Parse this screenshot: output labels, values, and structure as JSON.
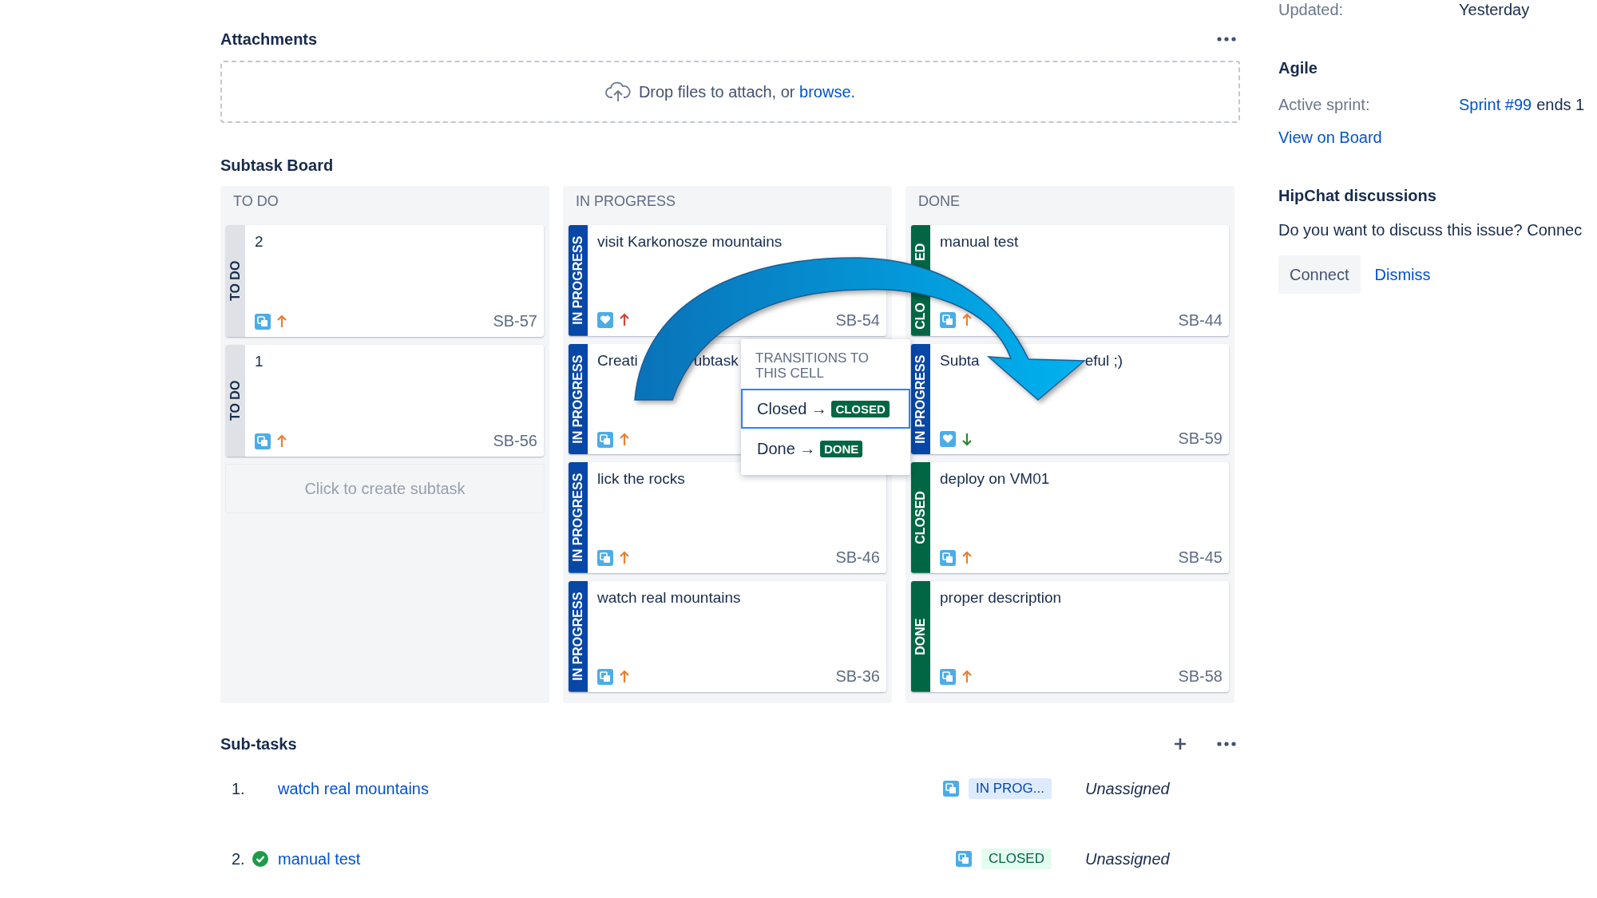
{
  "attachments": {
    "title": "Attachments",
    "dropzone_text": "Drop files to attach, or ",
    "dropzone_link": "browse."
  },
  "subtask_board": {
    "title": "Subtask Board",
    "columns": [
      {
        "name": "TO DO",
        "cards": [
          {
            "status": [
              "TO DO"
            ],
            "color": "#dfe1e6",
            "title": [
              "2"
            ],
            "kind": "subtask",
            "priority": {
              "kind": "up",
              "color": "#e97f33"
            },
            "key": "SB-57"
          },
          {
            "status": [
              "TO DO"
            ],
            "color": "#dfe1e6",
            "title": [
              "1"
            ],
            "kind": "subtask",
            "priority": {
              "kind": "up",
              "color": "#e97f33"
            },
            "key": "SB-56"
          }
        ],
        "create_text": "Click to create subtask"
      },
      {
        "name": "IN PROGRESS",
        "cards": [
          {
            "status": [
              "IN PROGRESS"
            ],
            "color": "#0747a6",
            "title": [
              "visit Karkonosze mountains"
            ],
            "kind": "story",
            "priority": {
              "kind": "up",
              "color": "#d04437"
            },
            "key": "SB-54"
          },
          {
            "status": [
              "IN PROGRESS"
            ],
            "color": "#0747a6",
            "title": [
              "Creati",
              "ubtask"
            ],
            "kind": "subtask",
            "priority": {
              "kind": "up",
              "color": "#e97f33"
            }
          },
          {
            "status": [
              "IN PROGRESS"
            ],
            "color": "#0747a6",
            "title": [
              "lick the rocks"
            ],
            "kind": "subtask",
            "priority": {
              "kind": "up",
              "color": "#e97f33"
            },
            "key": "SB-46"
          },
          {
            "status": [
              "IN PROGRESS"
            ],
            "color": "#0747a6",
            "title": [
              "watch real mountains"
            ],
            "kind": "subtask",
            "priority": {
              "kind": "up",
              "color": "#e97f33"
            },
            "key": "SB-36"
          }
        ]
      },
      {
        "name": "DONE",
        "cards": [
          {
            "status": [
              "CLO",
              "ED"
            ],
            "color": "#006644",
            "title": [
              "manual test"
            ],
            "kind": "subtask",
            "priority": {
              "kind": "up",
              "color": "#e97f33"
            },
            "key": "SB-44"
          },
          {
            "status": [
              "IN PROGRESS"
            ],
            "color": "#0747a6",
            "title": [
              "Subta",
              "eful ;)"
            ],
            "kind": "story",
            "priority": {
              "kind": "down",
              "color": "#2a8735"
            },
            "key": "SB-59"
          },
          {
            "status": [
              "CLOSED"
            ],
            "color": "#006644",
            "title": [
              "deploy on VM01"
            ],
            "kind": "subtask",
            "priority": {
              "kind": "up",
              "color": "#e97f33"
            },
            "key": "SB-45"
          },
          {
            "status": [
              "DONE"
            ],
            "color": "#006644",
            "title": [
              "proper description"
            ],
            "kind": "subtask",
            "priority": {
              "kind": "up",
              "color": "#e97f33"
            },
            "key": "SB-58"
          }
        ]
      }
    ],
    "transitions_popup": {
      "title": "TRANSITIONS TO THIS CELL",
      "options": [
        {
          "label": "Closed",
          "arrow": "→",
          "status": "CLOSED",
          "selected": true
        },
        {
          "label": "Done",
          "arrow": "→",
          "status": "DONE",
          "selected": false
        }
      ]
    }
  },
  "subtasks": {
    "title": "Sub-tasks",
    "rows": [
      {
        "number": "1.",
        "done": false,
        "summary": "watch real mountains",
        "status": "IN PROG...",
        "kind": "inprogress",
        "assignee": "Unassigned"
      },
      {
        "number": "2.",
        "done": true,
        "summary": "manual test",
        "status": "CLOSED",
        "kind": "done",
        "assignee": "Unassigned"
      }
    ]
  },
  "sidebar": {
    "updated_label": "Updated:",
    "updated_value": "Yesterday",
    "agile": {
      "title": "Agile",
      "sprint_label": "Active sprint:",
      "sprint_link": "Sprint #99",
      "sprint_rest": "ends 1",
      "board_link": "View on Board"
    },
    "hipchat": {
      "title": "HipChat discussions",
      "text": "Do you want to discuss this issue? Connec",
      "buttons": [
        "Connect",
        "Dismiss"
      ]
    }
  }
}
